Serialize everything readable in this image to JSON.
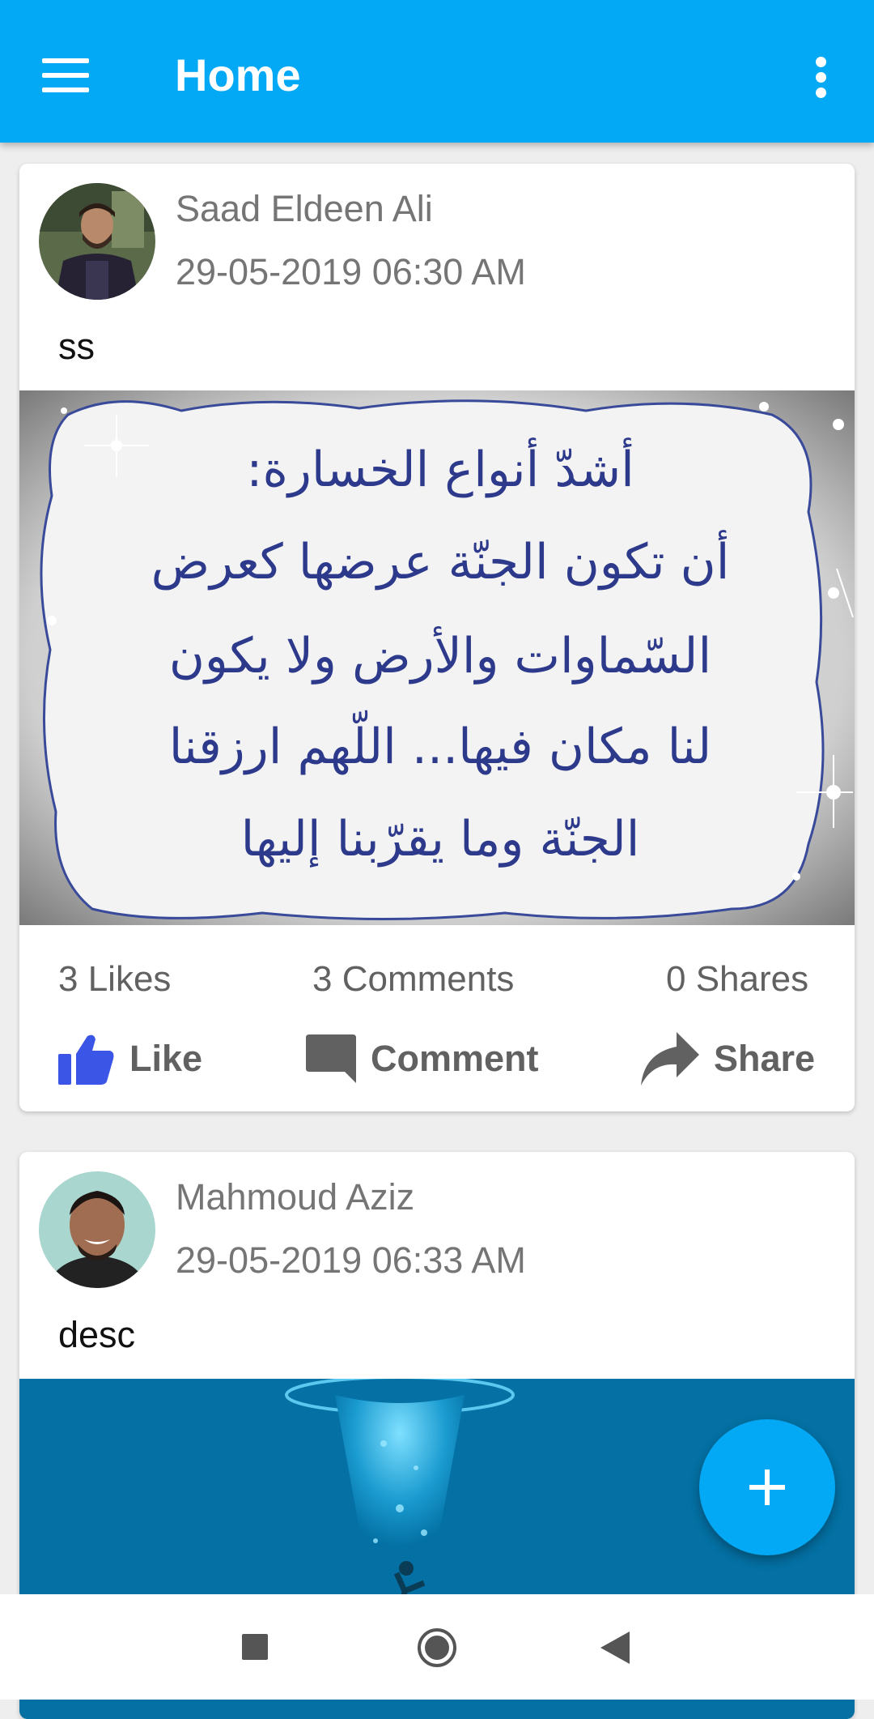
{
  "appbar": {
    "title": "Home",
    "menu_icon": "hamburger-menu-icon",
    "overflow_icon": "more-vert-icon",
    "color": "#03a9f4"
  },
  "posts": [
    {
      "author": "Saad Eldeen Ali",
      "timestamp": "29-05-2019 06:30 AM",
      "description": "ss",
      "image_text": [
        "أشدّ أنواع الخسارة:",
        "أن تكون الجنّة عرضها كعرض",
        "السّماوات والأرض ولا يكون",
        "لنا مكان فيها... اللّهم ارزقنا",
        "الجنّة وما يقرّبنا إليها"
      ],
      "likes": "3 Likes",
      "comments": "3 Comments",
      "shares": "0 Shares"
    },
    {
      "author": "Mahmoud Aziz",
      "timestamp": "29-05-2019 06:33 AM",
      "description": "desc"
    }
  ],
  "actions": {
    "like": "Like",
    "comment": "Comment",
    "share": "Share",
    "like_color": "#3b55e6"
  },
  "fab": {
    "icon": "plus-icon"
  },
  "navbar": {
    "buttons": [
      "recents-square-icon",
      "home-circle-icon",
      "back-triangle-icon"
    ]
  }
}
